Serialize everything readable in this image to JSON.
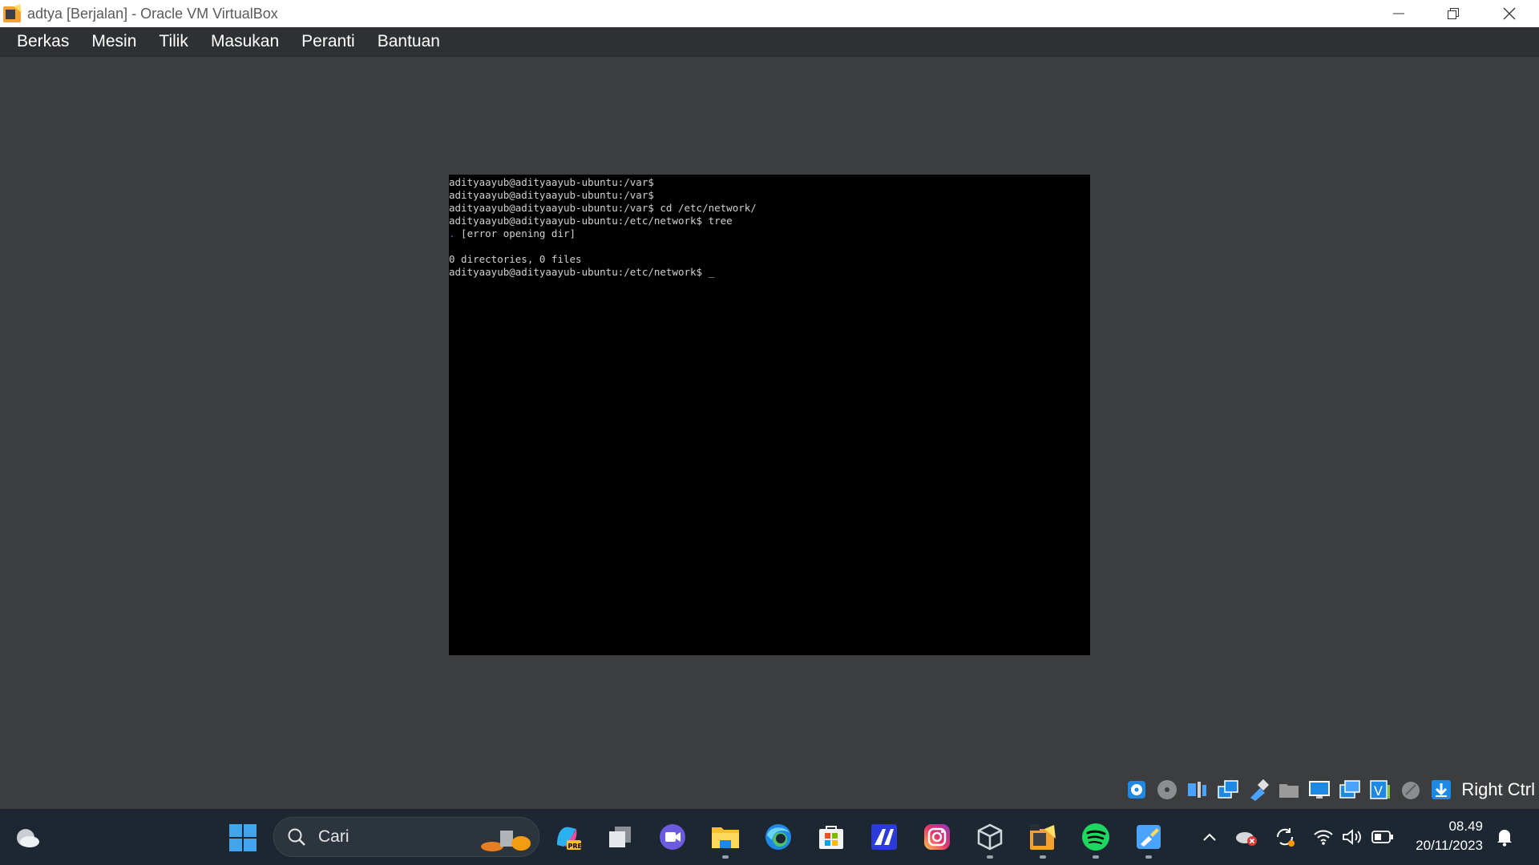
{
  "window": {
    "title": "adtya [Berjalan] - Oracle VM VirtualBox"
  },
  "menu": {
    "items": [
      "Berkas",
      "Mesin",
      "Tilik",
      "Masukan",
      "Peranti",
      "Bantuan"
    ]
  },
  "terminal": {
    "lines": [
      "adityaayub@adityaayub-ubuntu:/var$",
      "adityaayub@adityaayub-ubuntu:/var$",
      "adityaayub@adityaayub-ubuntu:/var$ cd /etc/network/",
      "adityaayub@adityaayub-ubuntu:/etc/network$ tree",
      "  [error opening dir]",
      "",
      "0 directories, 0 files",
      "adityaayub@adityaayub-ubuntu:/etc/network$ _"
    ],
    "tree_dot": ".",
    "colors": {
      "background": "#000000",
      "text": "#d0d0d0",
      "tree_dot": "#3b5bdb"
    }
  },
  "statusbar": {
    "icons": [
      "hard-disk-icon",
      "optical-drive-icon",
      "audio-icon",
      "network-icon",
      "usb-icon",
      "shared-folder-icon",
      "display-icon",
      "recording-icon",
      "virtualization-icon",
      "mouse-integration-icon",
      "download-icon"
    ],
    "host_key": "Right Ctrl"
  },
  "taskbar": {
    "search_placeholder": "Cari",
    "apps": [
      "windows-start-icon",
      "copilot-icon",
      "task-view-icon",
      "meet-icon",
      "file-explorer-icon",
      "edge-icon",
      "store-icon",
      "app-icon",
      "instagram-icon",
      "virtualbox-icon",
      "app-icon",
      "spotify-icon",
      "paint-icon"
    ],
    "tray": [
      "chevron-up-icon",
      "onedrive-error-icon",
      "sync-icon",
      "wifi-icon",
      "volume-icon",
      "battery-icon"
    ],
    "time": "08.49",
    "date": "20/11/2023"
  }
}
